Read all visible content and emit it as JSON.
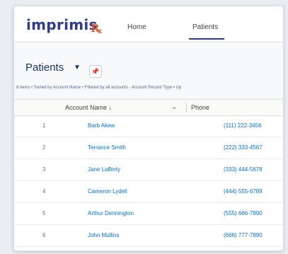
{
  "brand": {
    "logo_text": "imprimis",
    "logo_mark": "R",
    "logo_sub": "x"
  },
  "nav": {
    "items": [
      {
        "label": "Home"
      },
      {
        "label": "Patients"
      }
    ]
  },
  "list": {
    "title": "Patients",
    "meta": "8 items • Sorted by Account Name • Filtered by all accounts - Account Record Type • Up",
    "columns": {
      "account_name": "Account Name ↓",
      "phone": "Phone"
    },
    "rows": [
      {
        "num": "1",
        "name": "Barb Akew",
        "phone": "(111) 222-3456"
      },
      {
        "num": "2",
        "name": "Terrance Smith",
        "phone": "(222) 333-4567"
      },
      {
        "num": "3",
        "name": "Jane Lafferty",
        "phone": "(333) 444-5678"
      },
      {
        "num": "4",
        "name": "Cameron Lydell",
        "phone": "(444) 555-6789"
      },
      {
        "num": "5",
        "name": "Arthur Dennington",
        "phone": "(555) 666-7890"
      },
      {
        "num": "6",
        "name": "John Mullins",
        "phone": "(666) 777-7890"
      }
    ]
  },
  "icons": {
    "title_dropdown": "caret-down-icon",
    "pin": "pin-icon",
    "column_menu": "chevron-down-icon"
  },
  "colors": {
    "brand_blue": "#2d3c8e",
    "brand_orange": "#e0582b",
    "link": "#0070d2"
  }
}
